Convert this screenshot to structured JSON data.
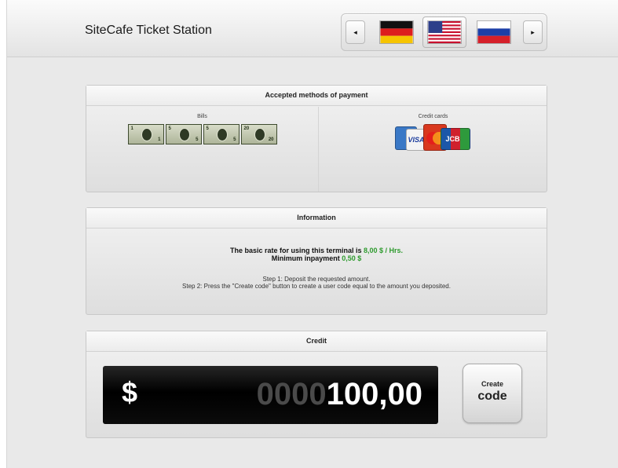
{
  "header": {
    "title": "SiteCafe Ticket Station",
    "languages": [
      {
        "name": "german-flag",
        "selected": false
      },
      {
        "name": "us-flag",
        "selected": true
      },
      {
        "name": "russian-flag",
        "selected": false
      }
    ],
    "prev_icon": "◂",
    "next_icon": "▸"
  },
  "payment": {
    "title": "Accepted methods of payment",
    "bills_label": "Bills",
    "cards_label": "Credit cards",
    "bill_values": [
      "1",
      "5",
      "5",
      "20"
    ],
    "card_names": [
      "VISA",
      "JCB"
    ]
  },
  "information": {
    "title": "Information",
    "rate_prefix": "The basic rate for using this terminal is ",
    "rate_value": "8,00 $ / Hrs.",
    "min_prefix": "Minimum inpayment ",
    "min_value": "0,50 $",
    "step1": "Step 1: Deposit the requested amount.",
    "step2": "Step 2: Press the \"Create code\" button to create a user code equal to the amount you deposited."
  },
  "credit": {
    "title": "Credit",
    "currency": "$",
    "amount_leading": "0000",
    "amount_value": "100,00",
    "create_line1": "Create",
    "create_line2": "code"
  },
  "colors": {
    "accent_green": "#2d9a2d",
    "display_bg": "#000000",
    "panel_bg": "#e6e6e6"
  }
}
